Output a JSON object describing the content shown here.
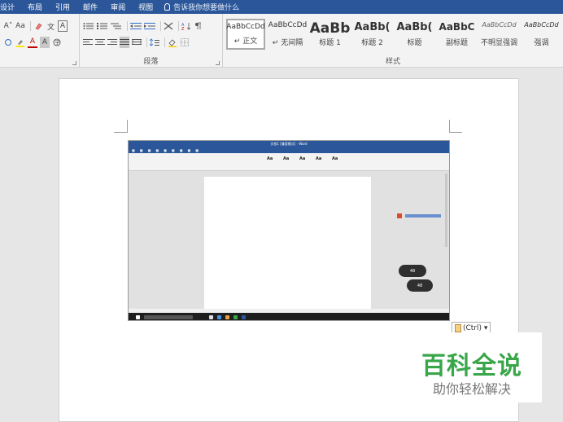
{
  "menubar": {
    "items": [
      "设计",
      "布局",
      "引用",
      "邮件",
      "审阅",
      "视图"
    ],
    "tell_me": "告诉我你想要做什么"
  },
  "font_group": {
    "row1": [
      "A˄",
      "Aa",
      "A",
      "A"
    ],
    "row2": [
      "A",
      "A",
      "A"
    ]
  },
  "paragraph_group": {
    "label": "段落"
  },
  "styles_group": {
    "label": "样式",
    "cards": [
      {
        "sample": "AaBbCcDd",
        "name": "正文",
        "selected": true
      },
      {
        "sample": "AaBbCcDd",
        "name": "无间隔"
      },
      {
        "sample": "AaBb",
        "name": "标题 1"
      },
      {
        "sample": "AaBb(",
        "name": "标题 2"
      },
      {
        "sample": "AaBb(",
        "name": "标题"
      },
      {
        "sample": "AaBbC",
        "name": "副标题"
      },
      {
        "sample": "AaBbCcDd",
        "name": "不明显强调"
      },
      {
        "sample": "AaBbCcDd",
        "name": "强调"
      }
    ]
  },
  "embedded_screenshot": {
    "title": "文档1 [兼容模式] - Word",
    "pill1": "48",
    "pill2": "48"
  },
  "paste_tag": {
    "label": "(Ctrl) ▾"
  },
  "watermark": {
    "title": "百科全说",
    "subtitle": "助你轻松解决"
  },
  "colors": {
    "accent": "#2b579a",
    "brand_green": "#3aa64a"
  }
}
